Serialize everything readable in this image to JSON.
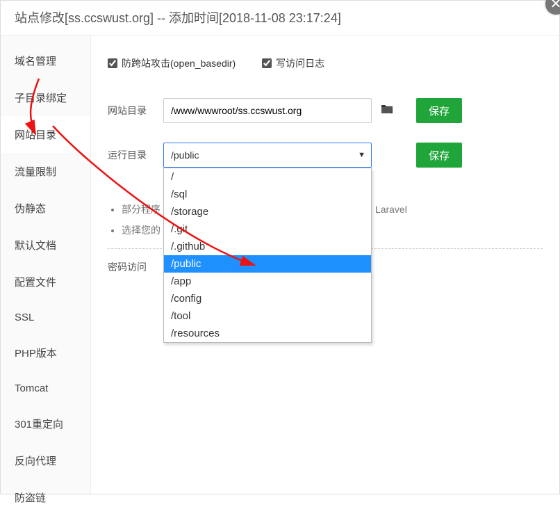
{
  "title": "站点修改[ss.ccswust.org] -- 添加时间[2018-11-08 23:17:24]",
  "sidebar": {
    "items": [
      {
        "label": "域名管理"
      },
      {
        "label": "子目录绑定"
      },
      {
        "label": "网站目录"
      },
      {
        "label": "流量限制"
      },
      {
        "label": "伪静态"
      },
      {
        "label": "默认文档"
      },
      {
        "label": "配置文件"
      },
      {
        "label": "SSL"
      },
      {
        "label": "PHP版本"
      },
      {
        "label": "Tomcat"
      },
      {
        "label": "301重定向"
      },
      {
        "label": "反向代理"
      },
      {
        "label": "防盗链"
      }
    ],
    "active_index": 2
  },
  "checkboxes": {
    "open_basedir_label": "防跨站攻击(open_basedir)",
    "open_basedir_checked": true,
    "access_log_label": "写访问日志",
    "access_log_checked": true
  },
  "site_dir": {
    "label": "网站目录",
    "value": "/www/wwwroot/ss.ccswust.org",
    "save_label": "保存"
  },
  "run_dir": {
    "label": "运行目录",
    "selected": "/public",
    "save_label": "保存",
    "options": [
      "/",
      "/sql",
      "/storage",
      "/.git",
      "/.github",
      "/public",
      "/app",
      "/config",
      "/tool",
      "/resources"
    ],
    "selected_index": 5
  },
  "hints": {
    "line1": "部分程序",
    "line1_tail": "P5，Laravel",
    "line2": "选择您的"
  },
  "password_label": "密码访问"
}
